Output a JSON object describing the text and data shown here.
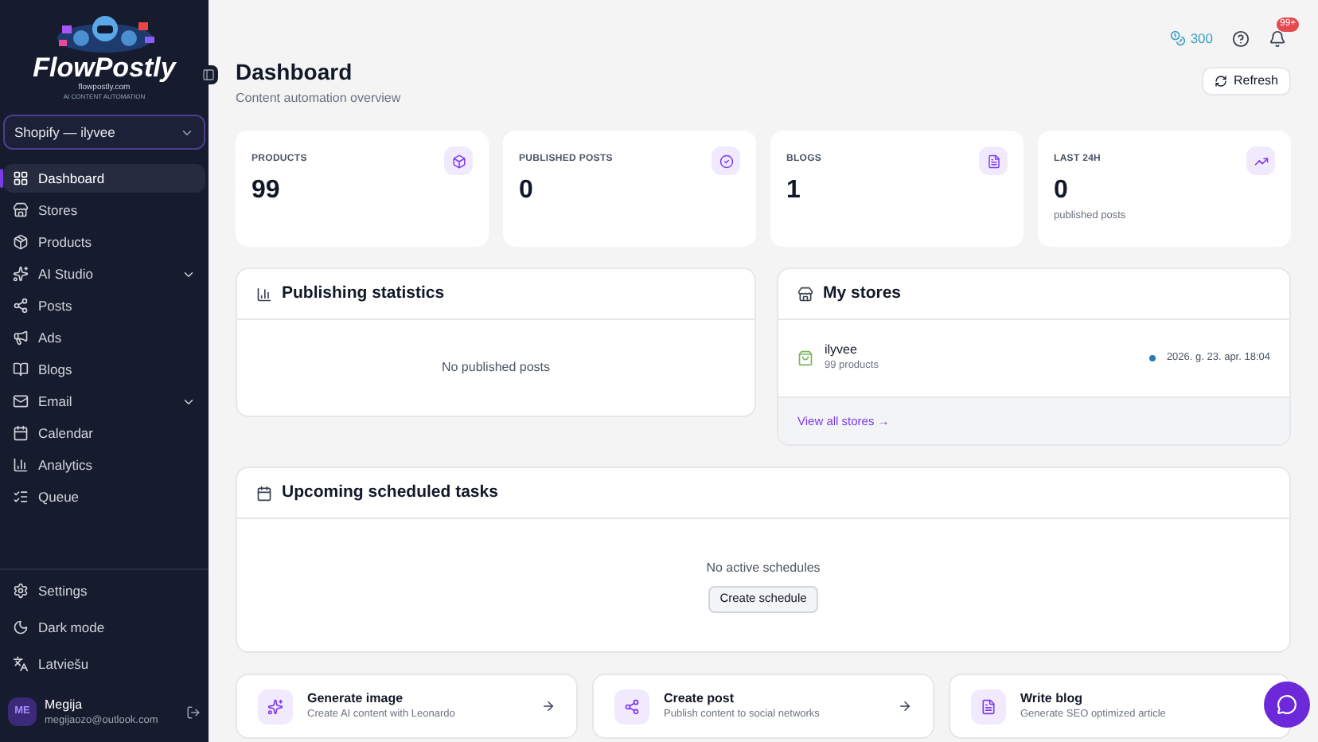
{
  "brand": {
    "name": "FlowPostly",
    "site": "flowpostly.com",
    "tagline": "AI CONTENT AUTOMATION"
  },
  "store_select": {
    "value": "Shopify — ilyvee"
  },
  "nav": [
    {
      "kind": "dashboard",
      "label": "Dashboard",
      "selected": true,
      "expandable": false
    },
    {
      "kind": "stores",
      "label": "Stores",
      "selected": false,
      "expandable": false
    },
    {
      "kind": "products",
      "label": "Products",
      "selected": false,
      "expandable": false
    },
    {
      "kind": "ai",
      "label": "AI Studio",
      "selected": false,
      "expandable": true
    },
    {
      "kind": "posts",
      "label": "Posts",
      "selected": false,
      "expandable": false
    },
    {
      "kind": "ads",
      "label": "Ads",
      "selected": false,
      "expandable": false
    },
    {
      "kind": "blogs",
      "label": "Blogs",
      "selected": false,
      "expandable": false
    },
    {
      "kind": "email",
      "label": "Email",
      "selected": false,
      "expandable": true
    },
    {
      "kind": "calendar",
      "label": "Calendar",
      "selected": false,
      "expandable": false
    },
    {
      "kind": "analytics",
      "label": "Analytics",
      "selected": false,
      "expandable": false
    },
    {
      "kind": "queue",
      "label": "Queue",
      "selected": false,
      "expandable": false
    }
  ],
  "bottom_nav": [
    {
      "kind": "settings",
      "label": "Settings"
    },
    {
      "kind": "moon",
      "label": "Dark mode"
    },
    {
      "kind": "language",
      "label": "Latviešu"
    }
  ],
  "user": {
    "initials": "ME",
    "name": "Megija",
    "email": "megijaozo@outlook.com"
  },
  "header": {
    "credits": "300",
    "notifications": "99+",
    "title": "Dashboard",
    "subtitle": "Content automation overview",
    "refresh": "Refresh"
  },
  "stats": [
    {
      "kind": "products",
      "label": "PRODUCTS",
      "value": "99"
    },
    {
      "kind": "posts",
      "label": "PUBLISHED POSTS",
      "value": "0"
    },
    {
      "kind": "blogs",
      "label": "BLOGS",
      "value": "1"
    },
    {
      "kind": "trend",
      "label": "LAST 24H",
      "value": "0",
      "note": "published posts"
    }
  ],
  "publishing": {
    "title": "Publishing statistics",
    "empty": "No published posts"
  },
  "stores": {
    "title": "My stores",
    "items": [
      {
        "name": "ilyvee",
        "products": "99 products",
        "date": "2026. g. 23. apr. 18:04",
        "color": "#2b7bb9"
      }
    ],
    "link": "View all stores →"
  },
  "schedule": {
    "title": "Upcoming scheduled tasks",
    "empty": "No active schedules",
    "button": "Create schedule"
  },
  "actions": [
    {
      "kind": "image",
      "title": "Generate image",
      "desc": "Create AI content with Leonardo",
      "arrow": true
    },
    {
      "kind": "post",
      "title": "Create post",
      "desc": "Publish content to social networks",
      "arrow": true
    },
    {
      "kind": "blog",
      "title": "Write blog",
      "desc": "Generate SEO optimized article",
      "arrow": false
    }
  ]
}
